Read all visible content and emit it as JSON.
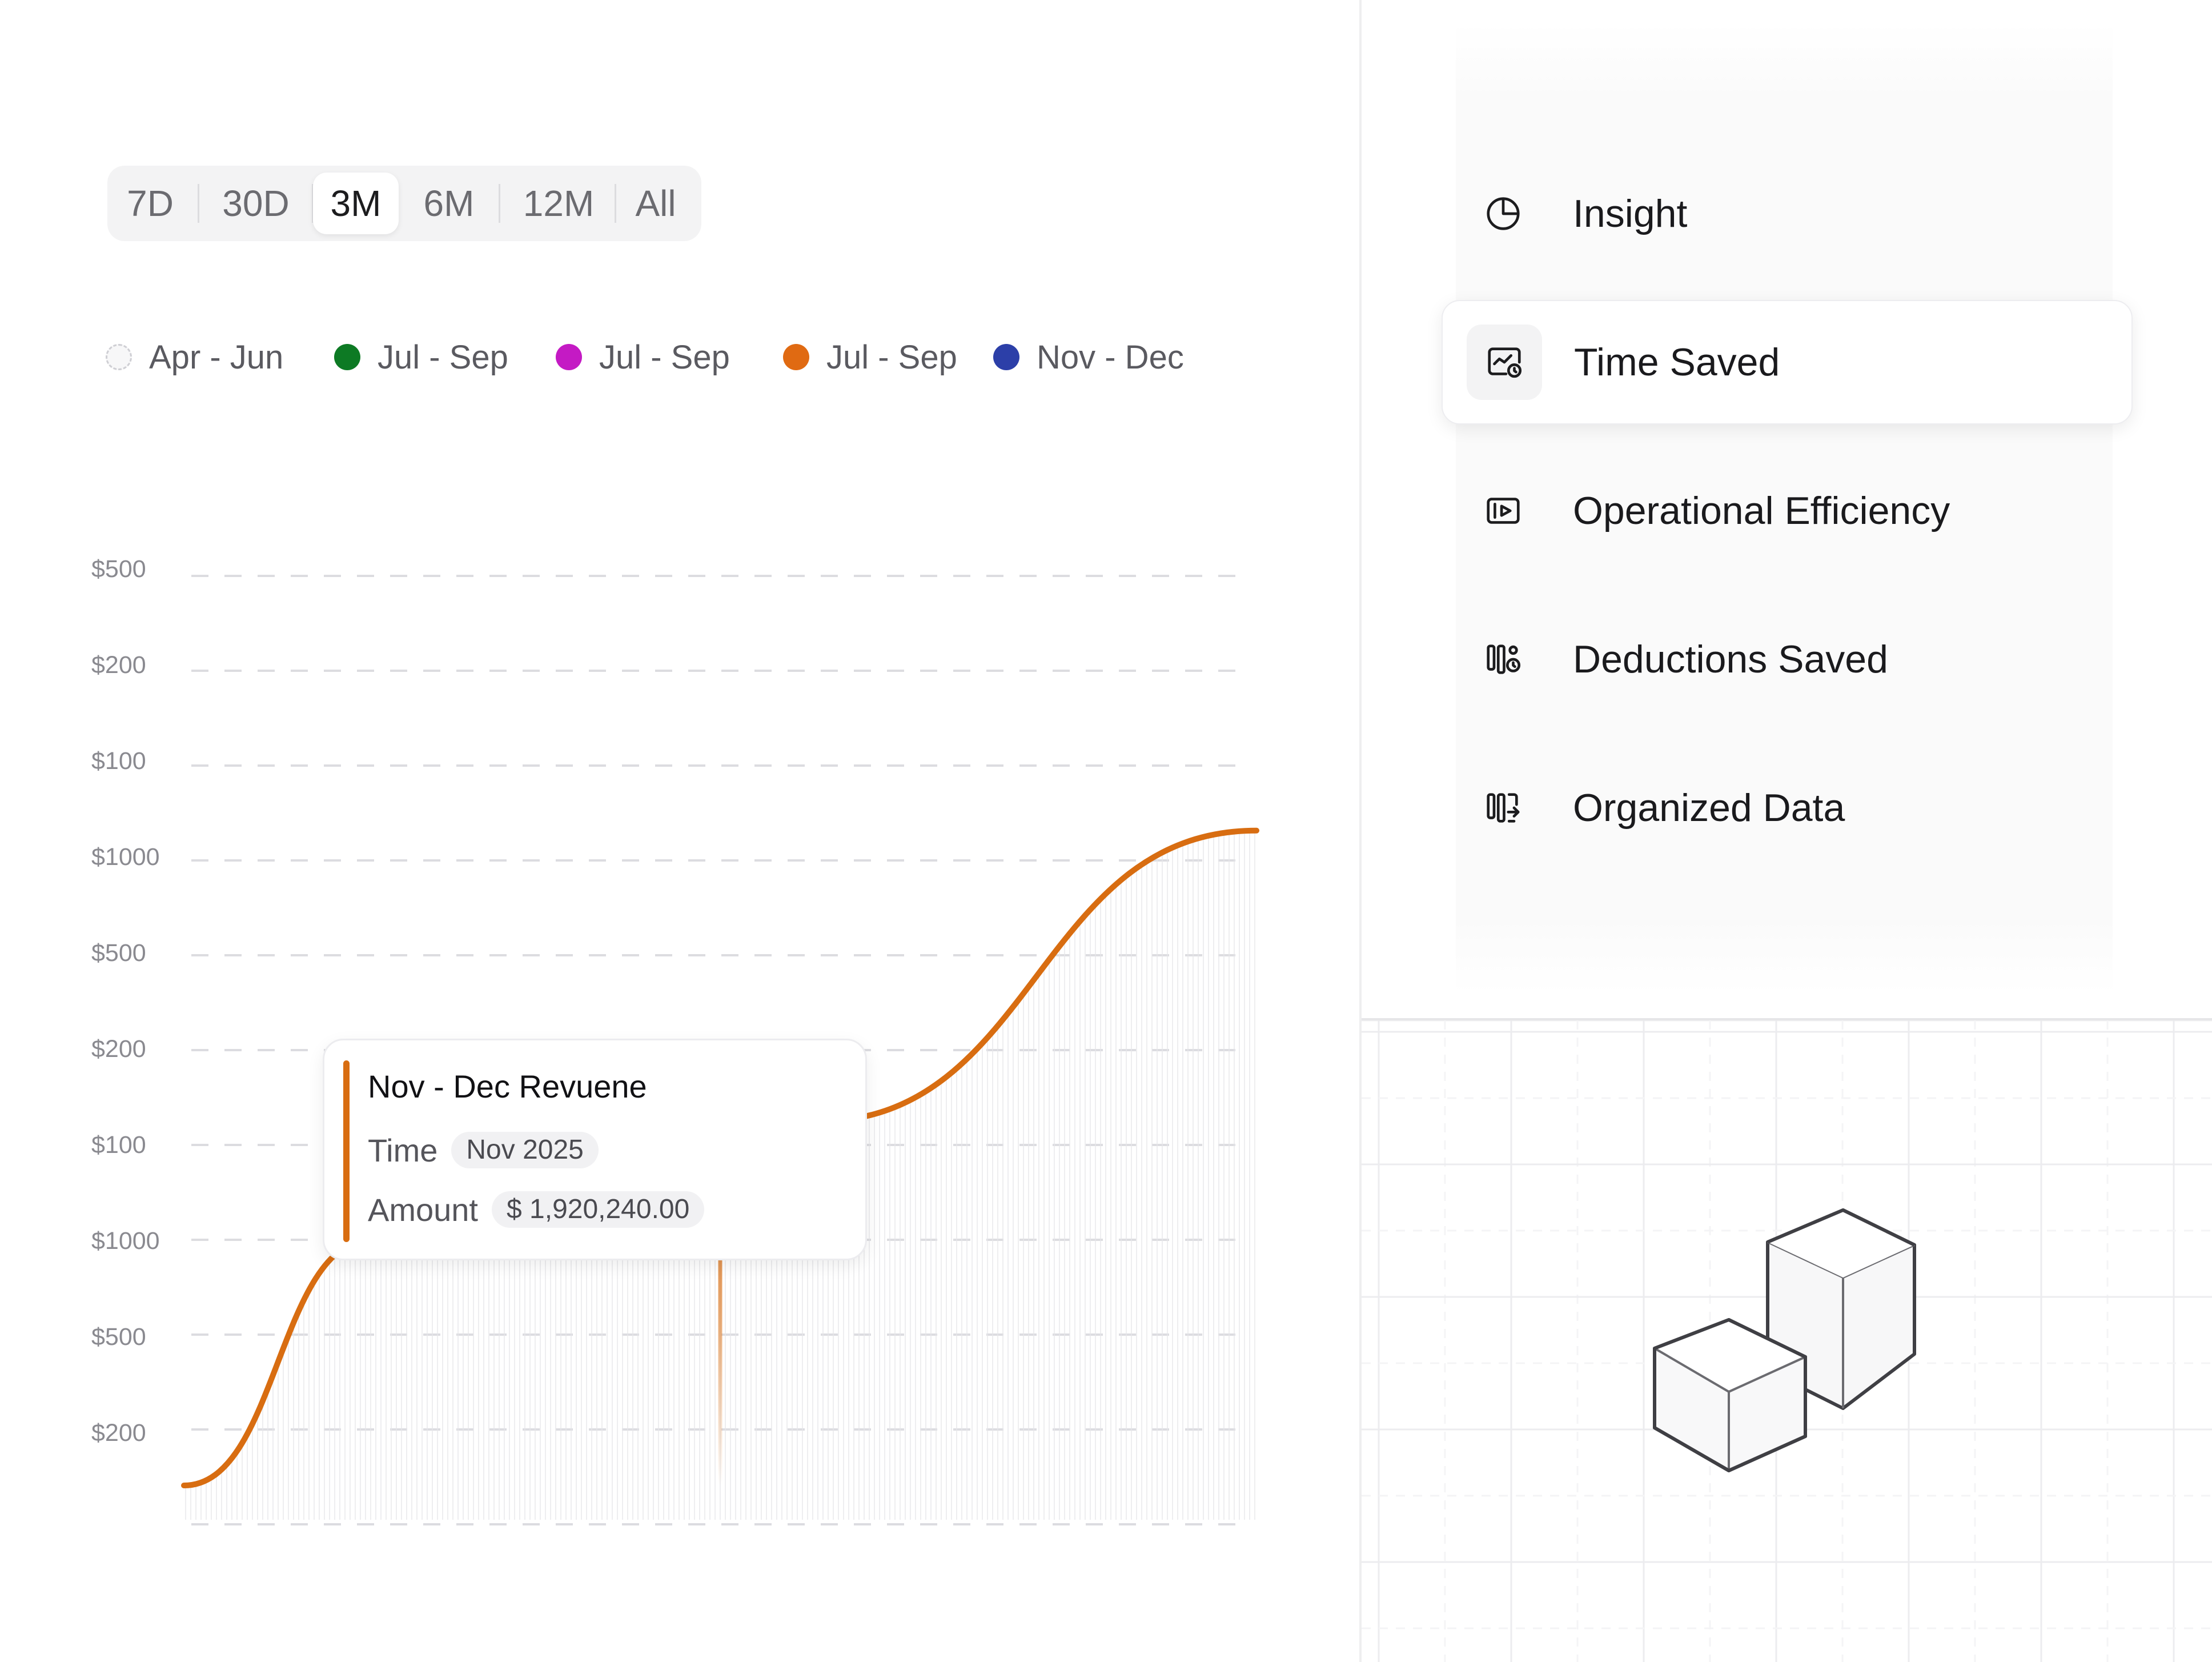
{
  "time_range": {
    "options": [
      "7D",
      "30D",
      "3M",
      "6M",
      "12M",
      "All"
    ],
    "selected": "3M"
  },
  "legend": [
    {
      "label": "Apr - Jun",
      "color": "#f2f2f3",
      "hollow": true
    },
    {
      "label": "Jul - Sep",
      "color": "#0d7a24"
    },
    {
      "label": "Jul - Sep",
      "color": "#c41ac4"
    },
    {
      "label": "Jul - Sep",
      "color": "#e06a12"
    },
    {
      "label": "Nov - Dec",
      "color": "#2c3fa8"
    }
  ],
  "chart_data": {
    "type": "line",
    "y_tick_labels": [
      "$500",
      "$200",
      "$100",
      "$1000",
      "$500",
      "$200",
      "$100",
      "$1000",
      "$500",
      "$200"
    ],
    "series": [
      {
        "color": "#d86d11",
        "points": [
          [
            0.0,
            0.0
          ],
          [
            0.175,
            0.27
          ],
          [
            0.33,
            0.27
          ],
          [
            0.5,
            0.398
          ],
          [
            0.59,
            0.4
          ],
          [
            1.0,
            0.72
          ]
        ]
      }
    ],
    "highlight_point": [
      0.5,
      0.398
    ],
    "grid": true
  },
  "tooltip": {
    "title": "Nov - Dec Revuene",
    "time_label": "Time",
    "time_value": "Nov 2025",
    "amount_label": "Amount",
    "amount_value": "$ 1,920,240.00"
  },
  "menu": {
    "items": [
      {
        "label": "Insight",
        "icon": "pie-chart-icon"
      },
      {
        "label": "Time Saved",
        "icon": "time-saved-icon",
        "active": true
      },
      {
        "label": "Operational Efficiency",
        "icon": "play-frame-icon"
      },
      {
        "label": "Deductions Saved",
        "icon": "deductions-icon"
      },
      {
        "label": "Organized Data",
        "icon": "organized-data-icon"
      }
    ]
  },
  "colors": {
    "accent": "#d86d11",
    "border": "#ececef",
    "muted_text": "#8a8a90"
  }
}
